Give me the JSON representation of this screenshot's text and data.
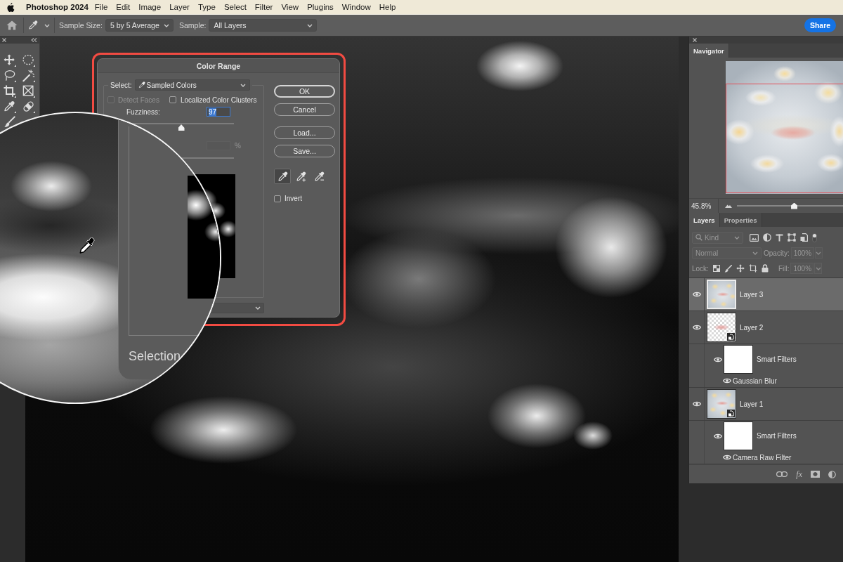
{
  "menu_bar": {
    "app_name": "Photoshop 2024",
    "items": [
      "File",
      "Edit",
      "Image",
      "Layer",
      "Type",
      "Select",
      "Filter",
      "View",
      "Plugins",
      "Window",
      "Help"
    ]
  },
  "options_bar": {
    "sample_size": {
      "label": "Sample Size:",
      "value": "5 by 5 Average"
    },
    "sample": {
      "label": "Sample:",
      "value": "All Layers"
    },
    "share_button": "Share"
  },
  "color_range_dialog": {
    "title": "Color Range",
    "select": {
      "label": "Select:",
      "value": "Sampled Colors"
    },
    "options": [
      {
        "label": "Detect Faces",
        "checked": false,
        "disabled": true
      },
      {
        "label": "Localized Color Clusters",
        "checked": false,
        "disabled": false
      }
    ],
    "fuzziness": {
      "label": "Fuzziness:",
      "value": "97",
      "text_selected": true,
      "level": 0.5
    },
    "range": {
      "unit": "%",
      "disabled": true
    },
    "buttons": [
      {
        "label": "OK",
        "default": true
      },
      {
        "label": "Cancel",
        "default": false
      },
      {
        "label": "Load...",
        "default": false
      },
      {
        "label": "Save...",
        "default": false
      }
    ],
    "eyedroppers": [
      {
        "kind": "sample",
        "selected": true
      },
      {
        "kind": "add",
        "selected": false
      },
      {
        "kind": "subtract",
        "selected": false
      }
    ],
    "invert": {
      "label": "Invert",
      "checked": false
    }
  },
  "magnifier": {
    "label": "Selection"
  },
  "navigator": {
    "tab": "Navigator",
    "zoom": "45.8%",
    "level": 0.54
  },
  "layers_panel": {
    "tabs": [
      {
        "label": "Layers",
        "selected": true
      },
      {
        "label": "Properties",
        "selected": false
      }
    ],
    "controls_disabled": true,
    "kind_filter": "Kind",
    "blend_mode": "Normal",
    "opacity": {
      "label": "Opacity:",
      "value": "100%"
    },
    "lock_label": "Lock:",
    "fill": {
      "label": "Fill:",
      "value": "100%"
    },
    "layers": [
      {
        "name": "Layer 3",
        "selected": true,
        "visible": true,
        "kind": "pixel",
        "transparent": false
      },
      {
        "name": "Layer 2",
        "selected": false,
        "visible": true,
        "kind": "smart",
        "transparent": true,
        "filters_label": "Smart Filters",
        "filters_visible": true,
        "filters": [
          {
            "name": "Gaussian Blur",
            "visible": true
          }
        ]
      },
      {
        "name": "Layer 1",
        "selected": false,
        "visible": true,
        "kind": "smart",
        "transparent": false,
        "filters_label": "Smart Filters",
        "filters_visible": true,
        "filters": [
          {
            "name": "Camera Raw Filter",
            "visible": true
          }
        ]
      }
    ],
    "footer": {
      "effects": "fx"
    }
  }
}
